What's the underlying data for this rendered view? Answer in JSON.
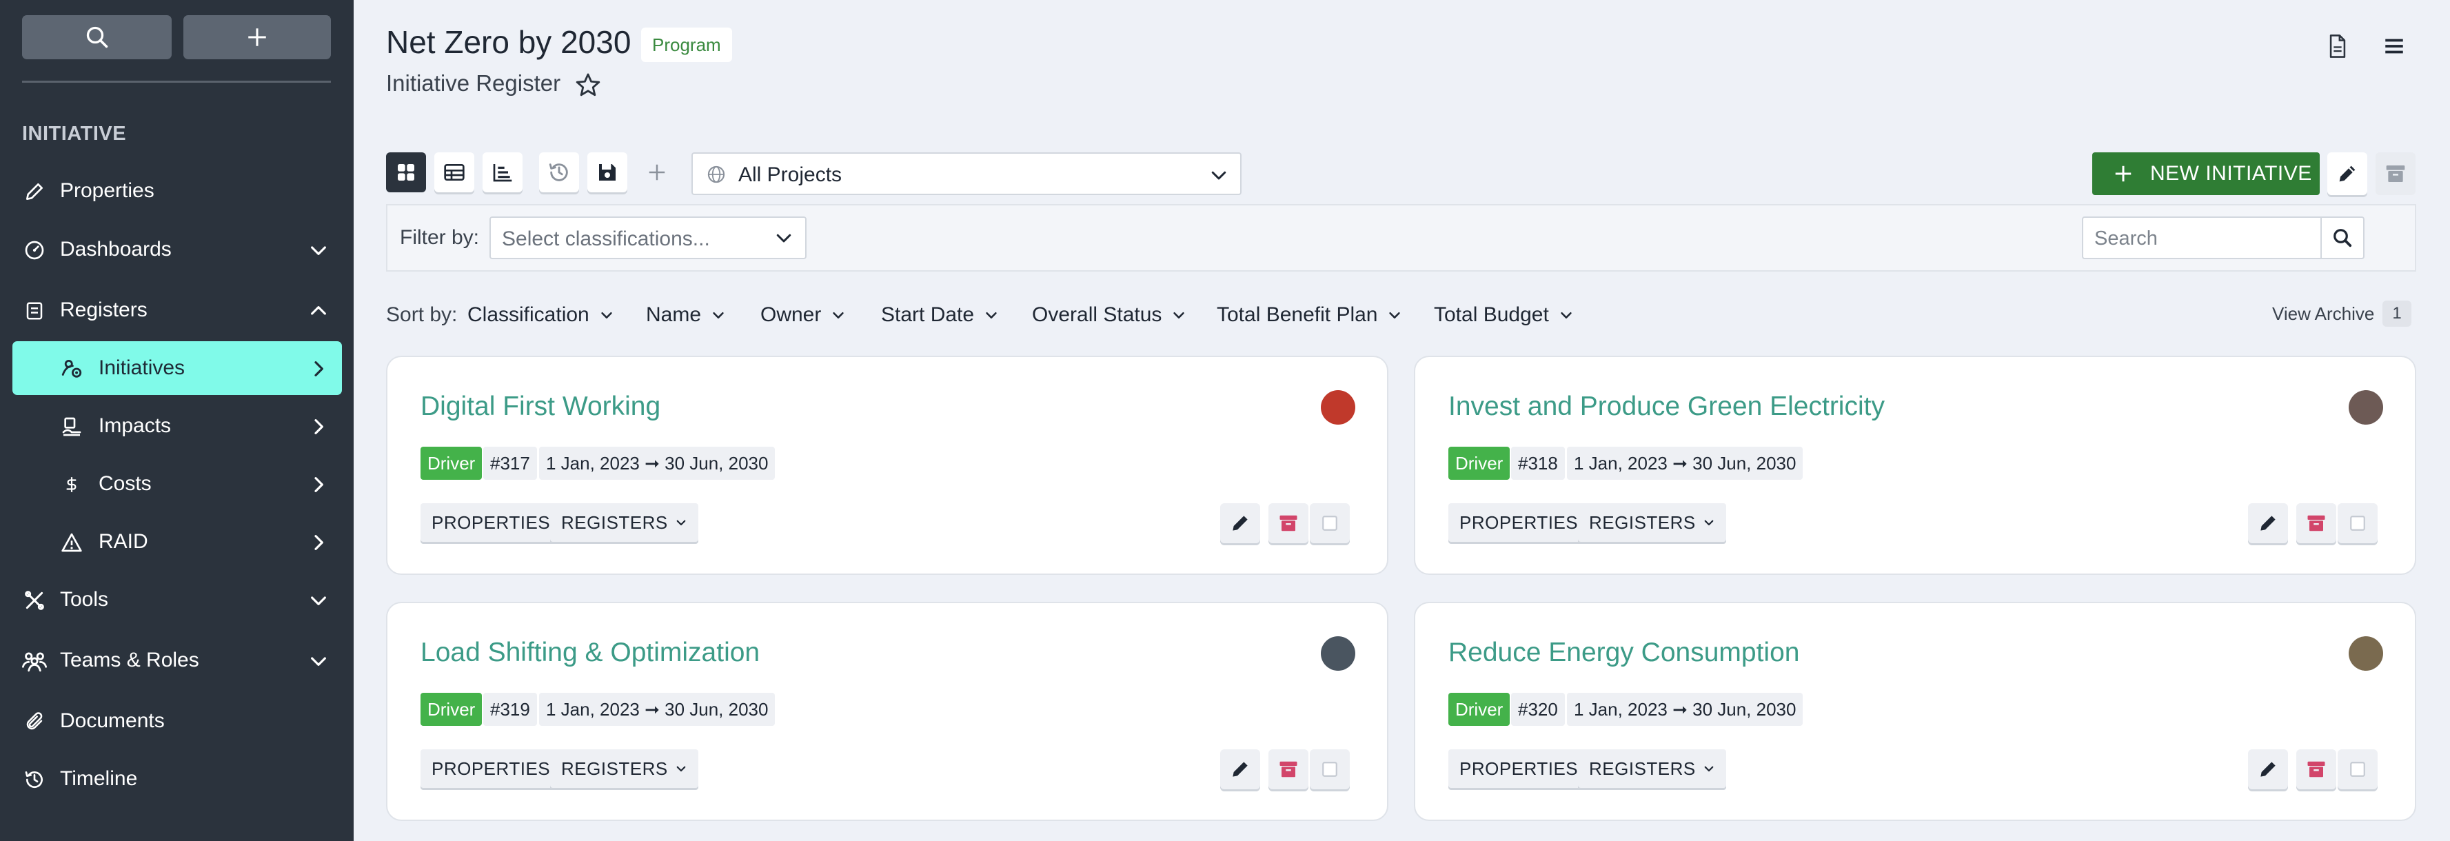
{
  "sidebar": {
    "section_label": "INITIATIVE",
    "items": [
      {
        "label": "Properties"
      },
      {
        "label": "Dashboards"
      },
      {
        "label": "Registers"
      },
      {
        "label": "Initiatives"
      },
      {
        "label": "Impacts"
      },
      {
        "label": "Costs"
      },
      {
        "label": "RAID"
      },
      {
        "label": "Tools"
      },
      {
        "label": "Teams & Roles"
      },
      {
        "label": "Documents"
      },
      {
        "label": "Timeline"
      }
    ]
  },
  "header": {
    "title": "Net Zero by 2030",
    "badge": "Program",
    "subtitle": "Initiative Register"
  },
  "toolbar": {
    "project_select": "All Projects",
    "new_initiative_label": "NEW INITIATIVE"
  },
  "filter": {
    "label": "Filter by:",
    "placeholder": "Select classifications...",
    "search_placeholder": "Search"
  },
  "sort": {
    "label": "Sort by:",
    "options": [
      "Classification",
      "Name",
      "Owner",
      "Start Date",
      "Overall Status",
      "Total Benefit Plan",
      "Total Budget"
    ],
    "view_archive": "View Archive",
    "archive_count": "1"
  },
  "cards": [
    {
      "title": "Digital First Working",
      "tag": "Driver",
      "id": "#317",
      "dates": "1 Jan, 2023 ➞ 30 Jun, 2030",
      "properties": "PROPERTIES",
      "registers": "REGISTERS",
      "avatar_color": "#c0392b"
    },
    {
      "title": "Invest and Produce Green Electricity",
      "tag": "Driver",
      "id": "#318",
      "dates": "1 Jan, 2023 ➞ 30 Jun, 2030",
      "properties": "PROPERTIES",
      "registers": "REGISTERS",
      "avatar_color": "#6d5a55"
    },
    {
      "title": "Load Shifting & Optimization",
      "tag": "Driver",
      "id": "#319",
      "dates": "1 Jan, 2023 ➞ 30 Jun, 2030",
      "properties": "PROPERTIES",
      "registers": "REGISTERS",
      "avatar_color": "#4a5560"
    },
    {
      "title": "Reduce Energy Consumption",
      "tag": "Driver",
      "id": "#320",
      "dates": "1 Jan, 2023 ➞ 30 Jun, 2030",
      "properties": "PROPERTIES",
      "registers": "REGISTERS",
      "avatar_color": "#7a6a4f"
    }
  ],
  "colors": {
    "sidebar_bg": "#2b333d",
    "active_item": "#80fae9",
    "accent_green": "#2f7d34",
    "driver_badge": "#44b24a",
    "card_title": "#3c9b87",
    "archive_red": "#d2456a"
  },
  "icons": {
    "sidebar_search": "search-icon",
    "sidebar_add": "plus-icon",
    "top_document": "document-icon",
    "top_menu": "hamburger-menu-icon",
    "favorite": "star-outline-icon"
  }
}
